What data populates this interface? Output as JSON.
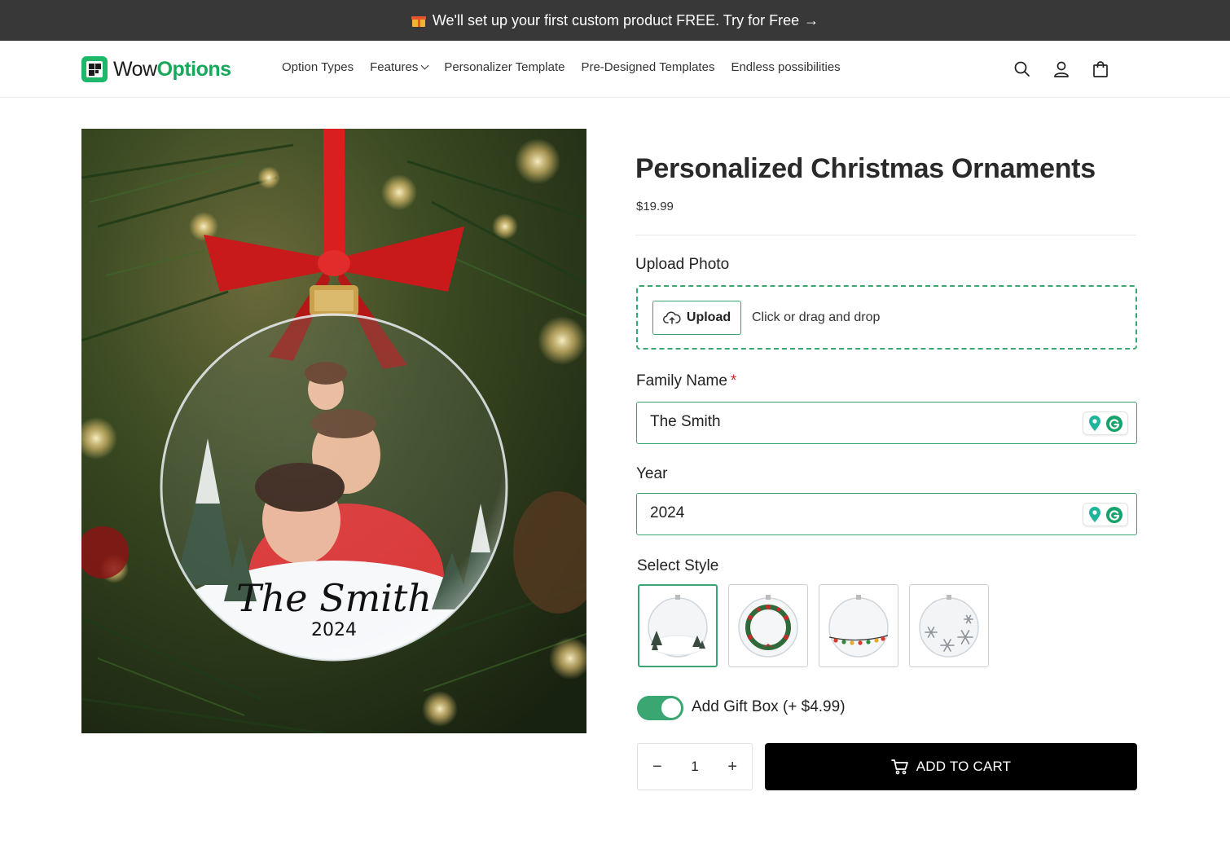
{
  "announcement": {
    "text": "We'll set up your first custom product FREE. Try for Free",
    "arrow": "→",
    "icon": "gift-icon"
  },
  "header": {
    "logo": {
      "word1": "Wow",
      "word2": "Options",
      "brand_color": "#17a85a"
    },
    "nav": [
      {
        "label": "Option Types"
      },
      {
        "label": "Features",
        "has_dropdown": true
      },
      {
        "label": "Personalizer Template"
      },
      {
        "label": "Pre-Designed Templates"
      },
      {
        "label": "Endless possibilities"
      }
    ],
    "icons": [
      "search-icon",
      "account-icon",
      "cart-bag-icon"
    ]
  },
  "product": {
    "title": "Personalized Christmas Ornaments",
    "price": "$19.99",
    "image": {
      "ornament_name": "The Smith",
      "ornament_year": "2024"
    },
    "upload": {
      "label": "Upload Photo",
      "button_label": "Upload",
      "hint": "Click or drag and drop"
    },
    "family_name": {
      "label": "Family Name",
      "required_mark": "*",
      "value": "The Smith"
    },
    "year": {
      "label": "Year",
      "value": "2024"
    },
    "style": {
      "label": "Select Style",
      "options": [
        {
          "name": "snowy-trees",
          "selected": true
        },
        {
          "name": "wreath",
          "selected": false
        },
        {
          "name": "string-lights",
          "selected": false
        },
        {
          "name": "snowflakes",
          "selected": false
        }
      ]
    },
    "gift_box": {
      "label": "Add Gift Box (+ $4.99)",
      "enabled": true
    },
    "quantity": {
      "minus": "−",
      "value": "1",
      "plus": "+"
    },
    "add_to_cart": "ADD TO CART"
  },
  "colors": {
    "accent": "#3aa672",
    "announce_bg": "#383838",
    "cart_bg": "#000000",
    "required": "#d9262c"
  }
}
